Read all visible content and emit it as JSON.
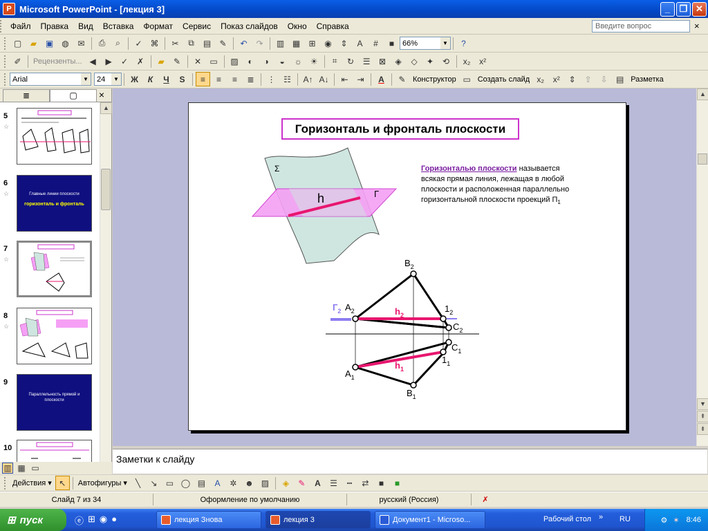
{
  "window": {
    "app_icon": "P",
    "title": "Microsoft PowerPoint - [лекция 3]",
    "min": "_",
    "max": "❐",
    "close": "✕"
  },
  "menu": {
    "items": [
      "Файл",
      "Правка",
      "Вид",
      "Вставка",
      "Формат",
      "Сервис",
      "Показ слайдов",
      "Окно",
      "Справка"
    ],
    "help_placeholder": "Введите вопрос",
    "close": "×"
  },
  "toolbar1": {
    "zoom": "66%"
  },
  "toolbar2": {
    "reviewers": "Рецензенты..."
  },
  "toolbar3": {
    "font": "Arial",
    "size": "24",
    "bold": "Ж",
    "italic": "К",
    "underline": "Ч",
    "shadow": "S",
    "designer": "Конструктор",
    "new_slide": "Создать слайд",
    "layout": "Разметка"
  },
  "panel": {
    "tab_outline": "≣",
    "tab_slides": "▢",
    "close": "×",
    "slides": [
      {
        "num": "5"
      },
      {
        "num": "6"
      },
      {
        "num": "7"
      },
      {
        "num": "8"
      },
      {
        "num": "9"
      },
      {
        "num": "10"
      }
    ],
    "thumb6_line1": "Главные линии плоскости",
    "thumb6_line2": "горизонталь и фронталь",
    "thumb9_line1": "Параллельность прямой и",
    "thumb9_line2": "плоскости"
  },
  "slide": {
    "title": "Горизонталь и фронталь плоскости",
    "def_term": "Горизонталью плоскости",
    "def_rest": " называется",
    "def_lines": [
      "всякая прямая линия, лежащая в любой",
      "плоскости и расположенная параллельно",
      "горизонтальной плоскости проекций П"
    ],
    "def_sub": "1",
    "labels": {
      "sigma": "Σ",
      "gamma": "Г",
      "h": "h",
      "B2": "B",
      "A2": "A",
      "G2": "Г",
      "h2": "h",
      "one2": "1",
      "C2": "C",
      "C1": "C",
      "one1": "1",
      "A1": "A",
      "B1": "B",
      "h1": "h",
      "sub2": "2",
      "sub1": "1"
    }
  },
  "notes": {
    "placeholder": "Заметки к слайду"
  },
  "drawing": {
    "actions": "Действия",
    "autoshapes": "Автофигуры"
  },
  "status": {
    "slide": "Слайд 7 из 34",
    "design": "Оформление по умолчанию",
    "lang": "русский (Россия)"
  },
  "taskbar": {
    "start": "пуск",
    "tasks": [
      "лекция Знова",
      "лекция 3",
      "Документ1 - Microso..."
    ],
    "desktop": "Рабочий стол",
    "lang": "RU",
    "time": "8:46"
  },
  "colors": {
    "accent": "#cc33cc",
    "magenta_line": "#e8166f",
    "plane": "#f5a0f5",
    "plane2": "#cfe6e0"
  }
}
